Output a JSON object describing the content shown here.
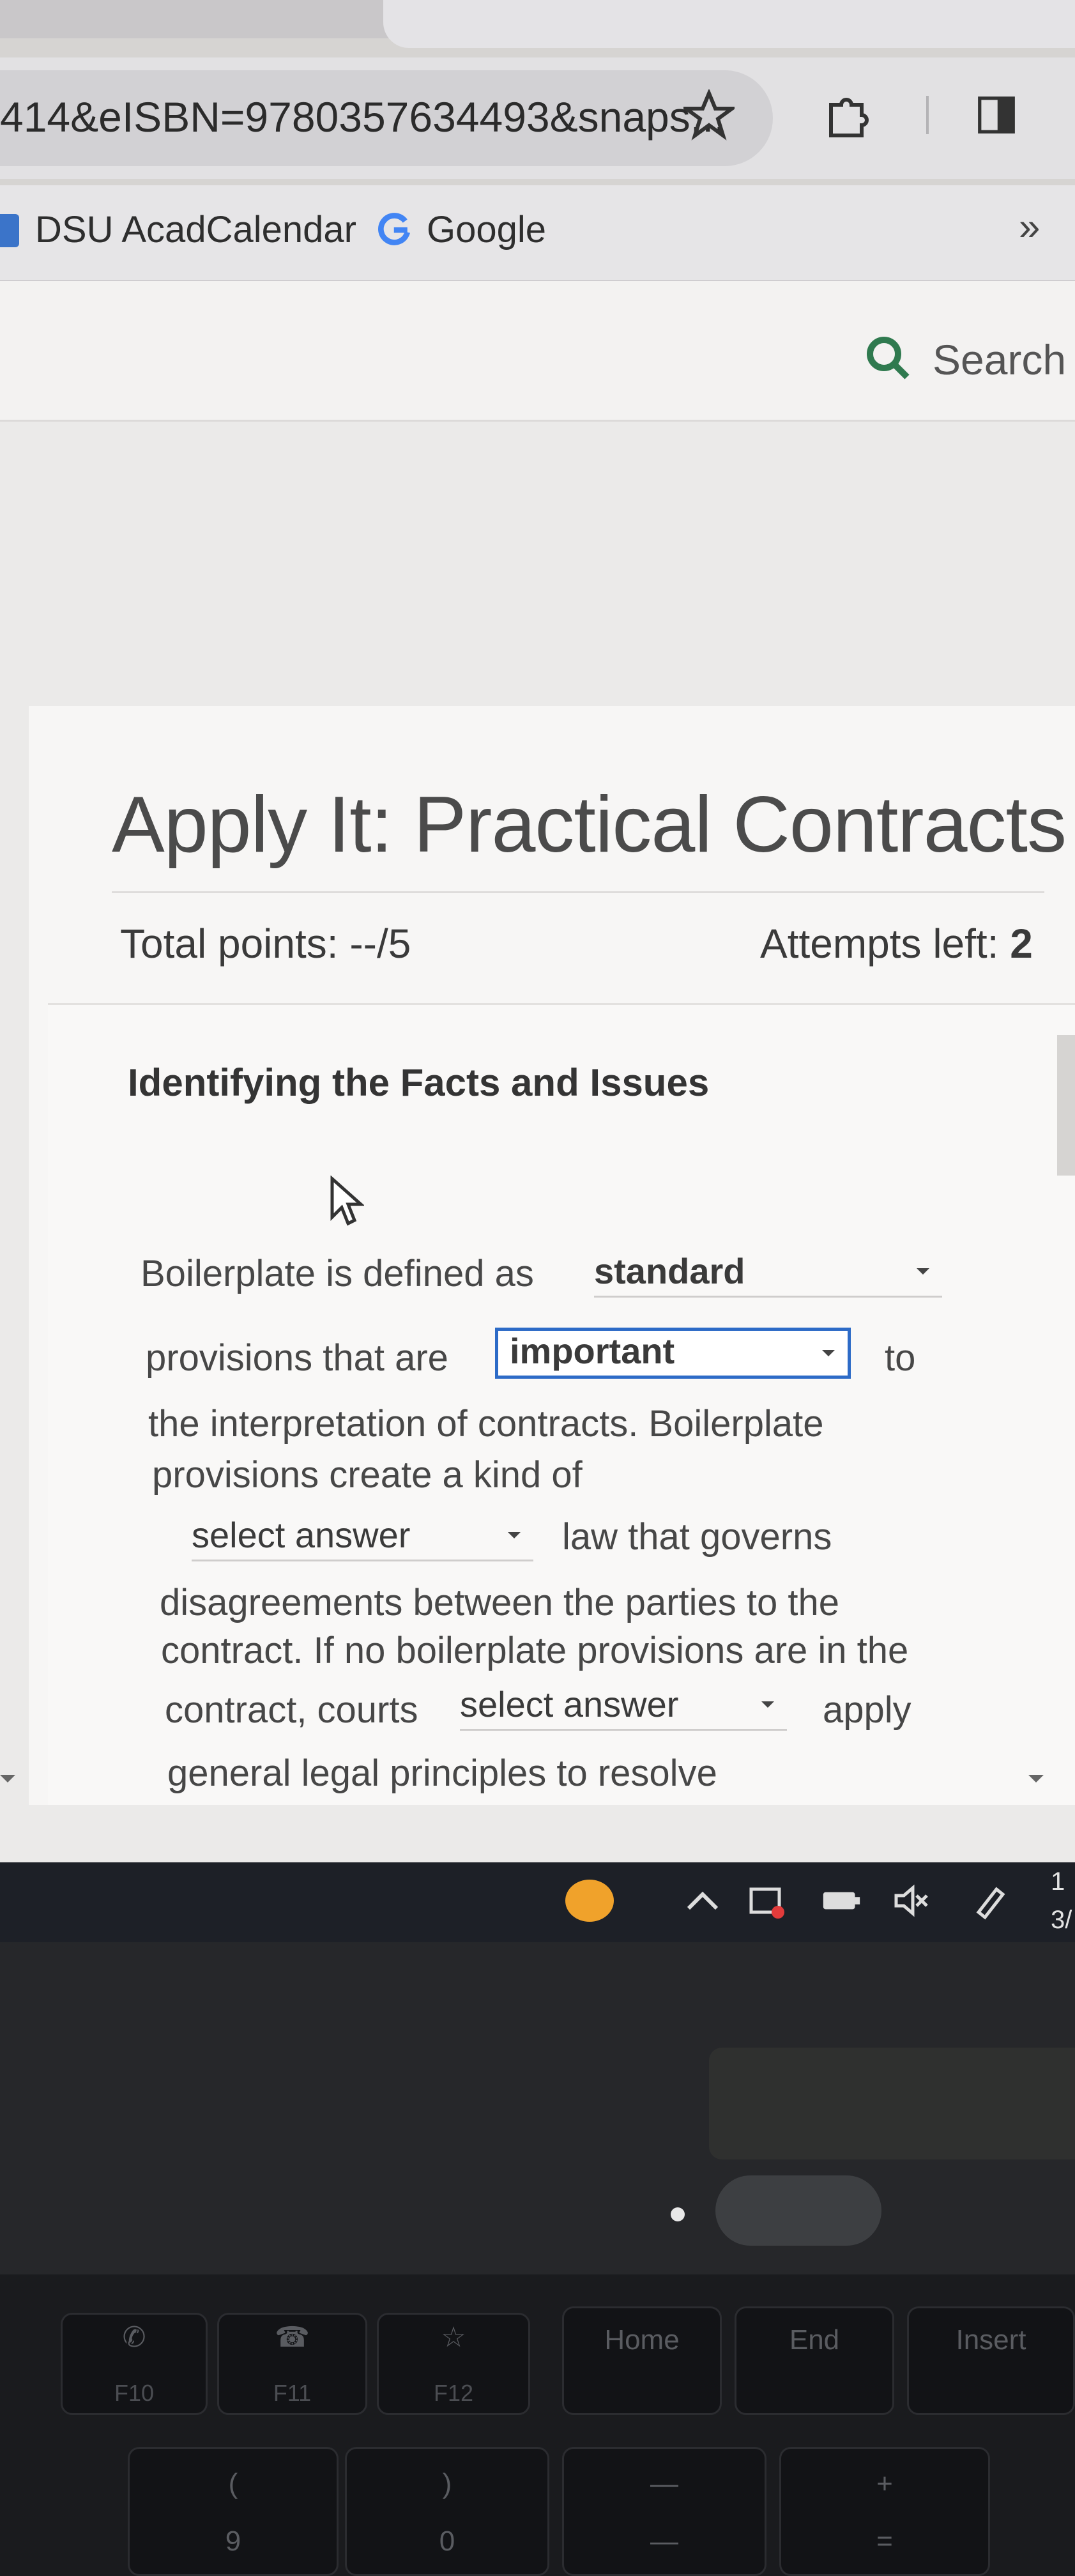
{
  "browser": {
    "url": "414&eISBN=9780357634493&snaps...",
    "bookmarks": [
      {
        "label": "DSU AcadCalendar"
      },
      {
        "label": "Google"
      }
    ],
    "more_bookmarks": "»"
  },
  "page_header": {
    "search_label": "Search t"
  },
  "activity": {
    "title": "Apply It: Practical Contracts",
    "total_points": "Total points: --/5",
    "attempts_label": "Attempts left:",
    "attempts_value": "2",
    "question_heading": "Identifying the Facts and Issues",
    "text": {
      "t1": "Boilerplate is defined as",
      "t2": "provisions that are",
      "t3": "to",
      "t4": "the interpretation of contracts. Boilerplate",
      "t5": "provisions create a kind of",
      "t6": "law that governs",
      "t7": "disagreements between the parties to the",
      "t8": "contract. If no boilerplate provisions are in the",
      "t9": "contract, courts",
      "t10": "apply",
      "t11": "general legal principles to resolve"
    },
    "dropdowns": {
      "d1": "standard",
      "d2": "important",
      "d3": "select answer",
      "d4": "select answer"
    }
  },
  "taskbar": {
    "time_line1": "1",
    "time_line2": "3/"
  },
  "keyboard": {
    "f10": "F10",
    "f11": "F11",
    "f12": "F12",
    "home": "Home",
    "end": "End",
    "insert": "Insert",
    "nine": "9",
    "lparen": "(",
    "zero": "0",
    "rparen": ")",
    "minus": "—",
    "underscore": "—",
    "plus": "+",
    "equals": "="
  },
  "colors": {
    "focus_border": "#2d6bc7",
    "taskbar": "#1d2027",
    "orange_app": "#f0a22b"
  }
}
